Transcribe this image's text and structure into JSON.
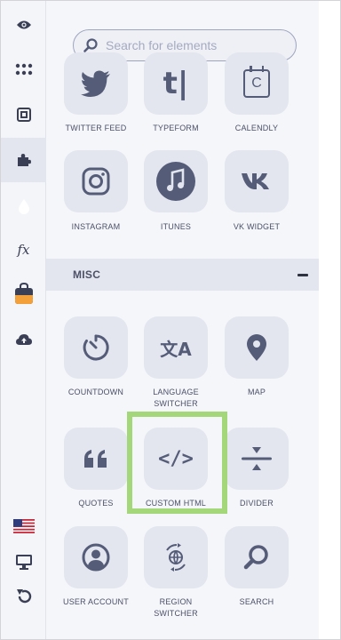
{
  "search": {
    "placeholder": "Search for elements"
  },
  "sections": {
    "misc": "MISC"
  },
  "elements": {
    "twitter": "TWITTER FEED",
    "typeform": "TYPEFORM",
    "calendly": "CALENDLY",
    "instagram": "INSTAGRAM",
    "itunes": "ITUNES",
    "vk": "VK WIDGET",
    "countdown": "COUNTDOWN",
    "language1": "LANGUAGE",
    "language2": "SWITCHER",
    "map": "MAP",
    "quotes": "QUOTES",
    "custom_html": "CUSTOM HTML",
    "divider": "DIVIDER",
    "user_account": "USER ACCOUNT",
    "region1": "REGION",
    "region2": "SWITCHER",
    "search": "SEARCH"
  },
  "rail": {
    "functions_label": "fx"
  },
  "icon_glyphs": {
    "typeform": "t|",
    "calendly": "C",
    "custom_html": "</>",
    "language": "文A"
  },
  "colors": {
    "icon": "#545c78",
    "accent_orange": "#f3a03a",
    "highlight": "#a4d77a"
  }
}
